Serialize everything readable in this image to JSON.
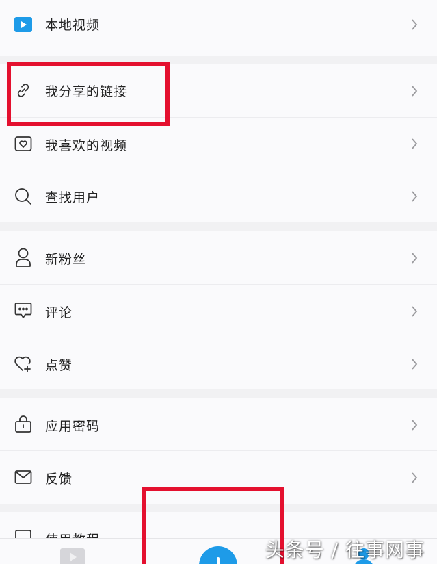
{
  "menu": {
    "local_video": "本地视频",
    "shared_links": "我分享的链接",
    "liked_videos": "我喜欢的视频",
    "find_users": "查找用户",
    "new_fans": "新粉丝",
    "comments": "评论",
    "likes": "点赞",
    "app_password": "应用密码",
    "feedback": "反馈",
    "tutorial": "使用教程"
  },
  "watermark": "头条号 / 往事网事",
  "colors": {
    "accent_blue": "#1e9be8",
    "highlight_red": "#e4102f"
  },
  "icons": [
    "play-icon",
    "link-icon",
    "heart-box-icon",
    "search-icon",
    "person-icon",
    "comment-icon",
    "heart-plus-icon",
    "lock-icon",
    "mail-icon",
    "book-icon",
    "chevron-right-icon",
    "plus-icon"
  ]
}
